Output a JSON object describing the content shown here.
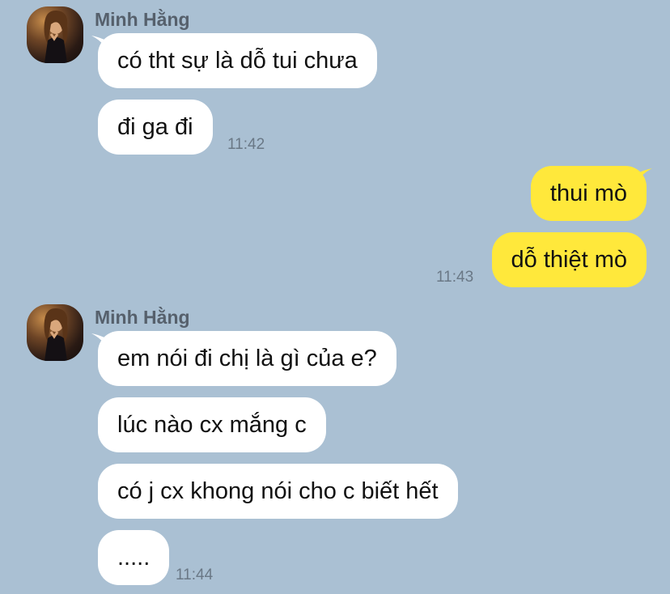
{
  "colors": {
    "background": "#aac0d3",
    "incoming": "#ffffff",
    "outgoing": "#ffe83b",
    "time": "#6a7886"
  },
  "group1": {
    "sender": "Minh Hằng",
    "messages": [
      "có tht sự là dỗ tui chưa",
      "đi ga đi"
    ],
    "time": "11:42"
  },
  "group2": {
    "messages": [
      "thui mò",
      "dỗ thiệt mò"
    ],
    "time": "11:43"
  },
  "group3": {
    "sender": "Minh Hằng",
    "messages": [
      "em nói đi chị là gì của e?",
      "lúc nào cx mắng c",
      "có j cx khong nói cho c biết hết",
      "....."
    ],
    "time": "11:44"
  }
}
